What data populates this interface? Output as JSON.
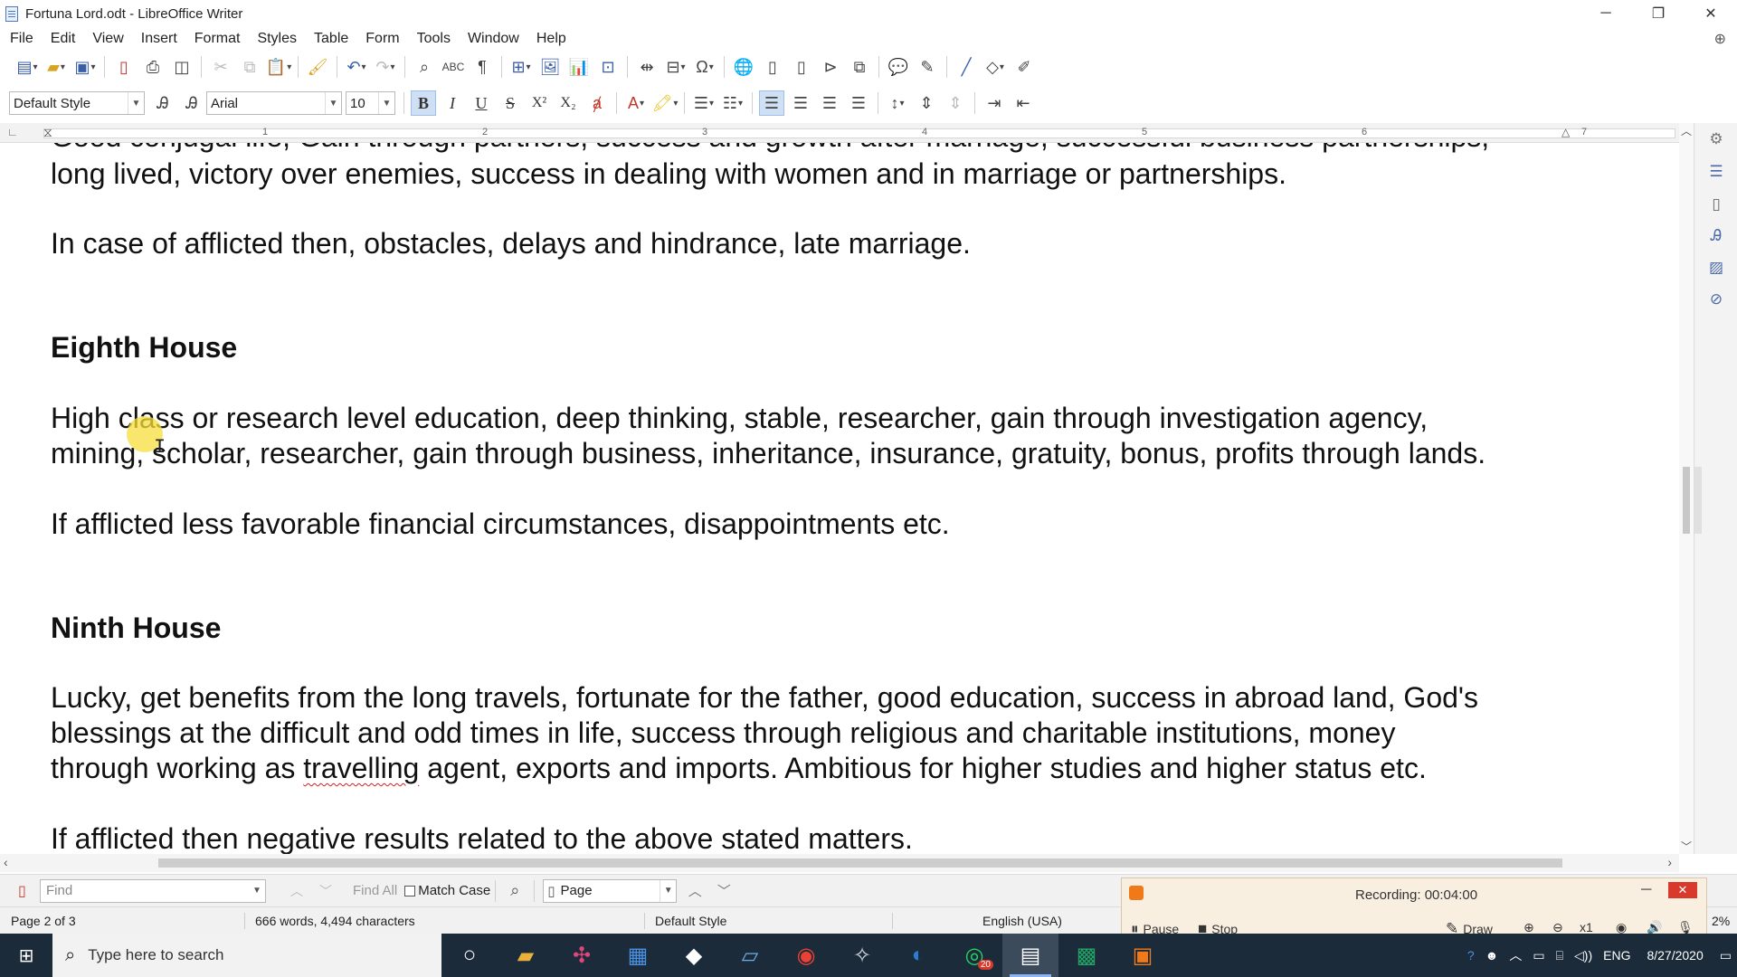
{
  "window": {
    "title": "Fortuna Lord.odt - LibreOffice Writer",
    "controls": {
      "minimize": "─",
      "maximize": "❐",
      "close": "✕"
    }
  },
  "menu": [
    "File",
    "Edit",
    "View",
    "Insert",
    "Format",
    "Styles",
    "Table",
    "Form",
    "Tools",
    "Window",
    "Help"
  ],
  "formatting": {
    "paragraph_style": "Default Style",
    "font_name": "Arial",
    "font_size": "10"
  },
  "ruler": {
    "numbers": [
      "1",
      "2",
      "3",
      "4",
      "5",
      "6",
      "7"
    ]
  },
  "document": {
    "partial_top_line": "Good conjugal life, Gain through partners, success and growth after marriage, successful business partnerships,",
    "paragraphs": {
      "seventh_body_end": "long lived, victory over enemies, success in dealing with women and in marriage or partnerships.",
      "seventh_afflicted": "In case of afflicted then, obstacles, delays and hindrance, late marriage.",
      "eighth_heading": "Eighth House",
      "eighth_body_1": "High class or research level education, deep thinking, stable, researcher, gain through investigation agency,",
      "eighth_body_2": "mining, scholar, researcher, gain through business, inheritance, insurance, gratuity, bonus, profits through lands.",
      "eighth_afflicted": "If afflicted less favorable financial circumstances, disappointments etc.",
      "ninth_heading": "Ninth House",
      "ninth_body_1": "Lucky, get benefits from the long travels, fortunate for the father, good education, success in abroad land, God's",
      "ninth_body_2": "blessings at the difficult and odd times in life, success through religious and charitable institutions, money",
      "ninth_body_3a": "through working as ",
      "ninth_body_3_misspelled": "travelling",
      "ninth_body_3b": " agent, exports and imports. Ambitious for higher studies and higher status etc.",
      "ninth_afflicted": "If afflicted then negative results related to the above stated matters."
    }
  },
  "findbar": {
    "placeholder": "Find",
    "find_all": "Find All",
    "match_case": "Match Case",
    "search_scope": "Page"
  },
  "statusbar": {
    "page": "Page 2 of 3",
    "words": "666 words, 4,494 characters",
    "style": "Default Style",
    "language": "English (USA)",
    "zoom": "2%"
  },
  "recording": {
    "title": "Recording:  00:04:00",
    "pause": "Pause",
    "stop": "Stop",
    "draw": "Draw",
    "speed": "x1"
  },
  "taskbar": {
    "search_placeholder": "Type here to search",
    "whatsapp_badge": "20",
    "language": "ENG",
    "date": "8/27/2020"
  },
  "colors": {
    "accent": "#3b5ea8",
    "taskbar": "#1c2b3a",
    "recording_bg": "#f8efe1",
    "spellcheck": "#d02020"
  }
}
